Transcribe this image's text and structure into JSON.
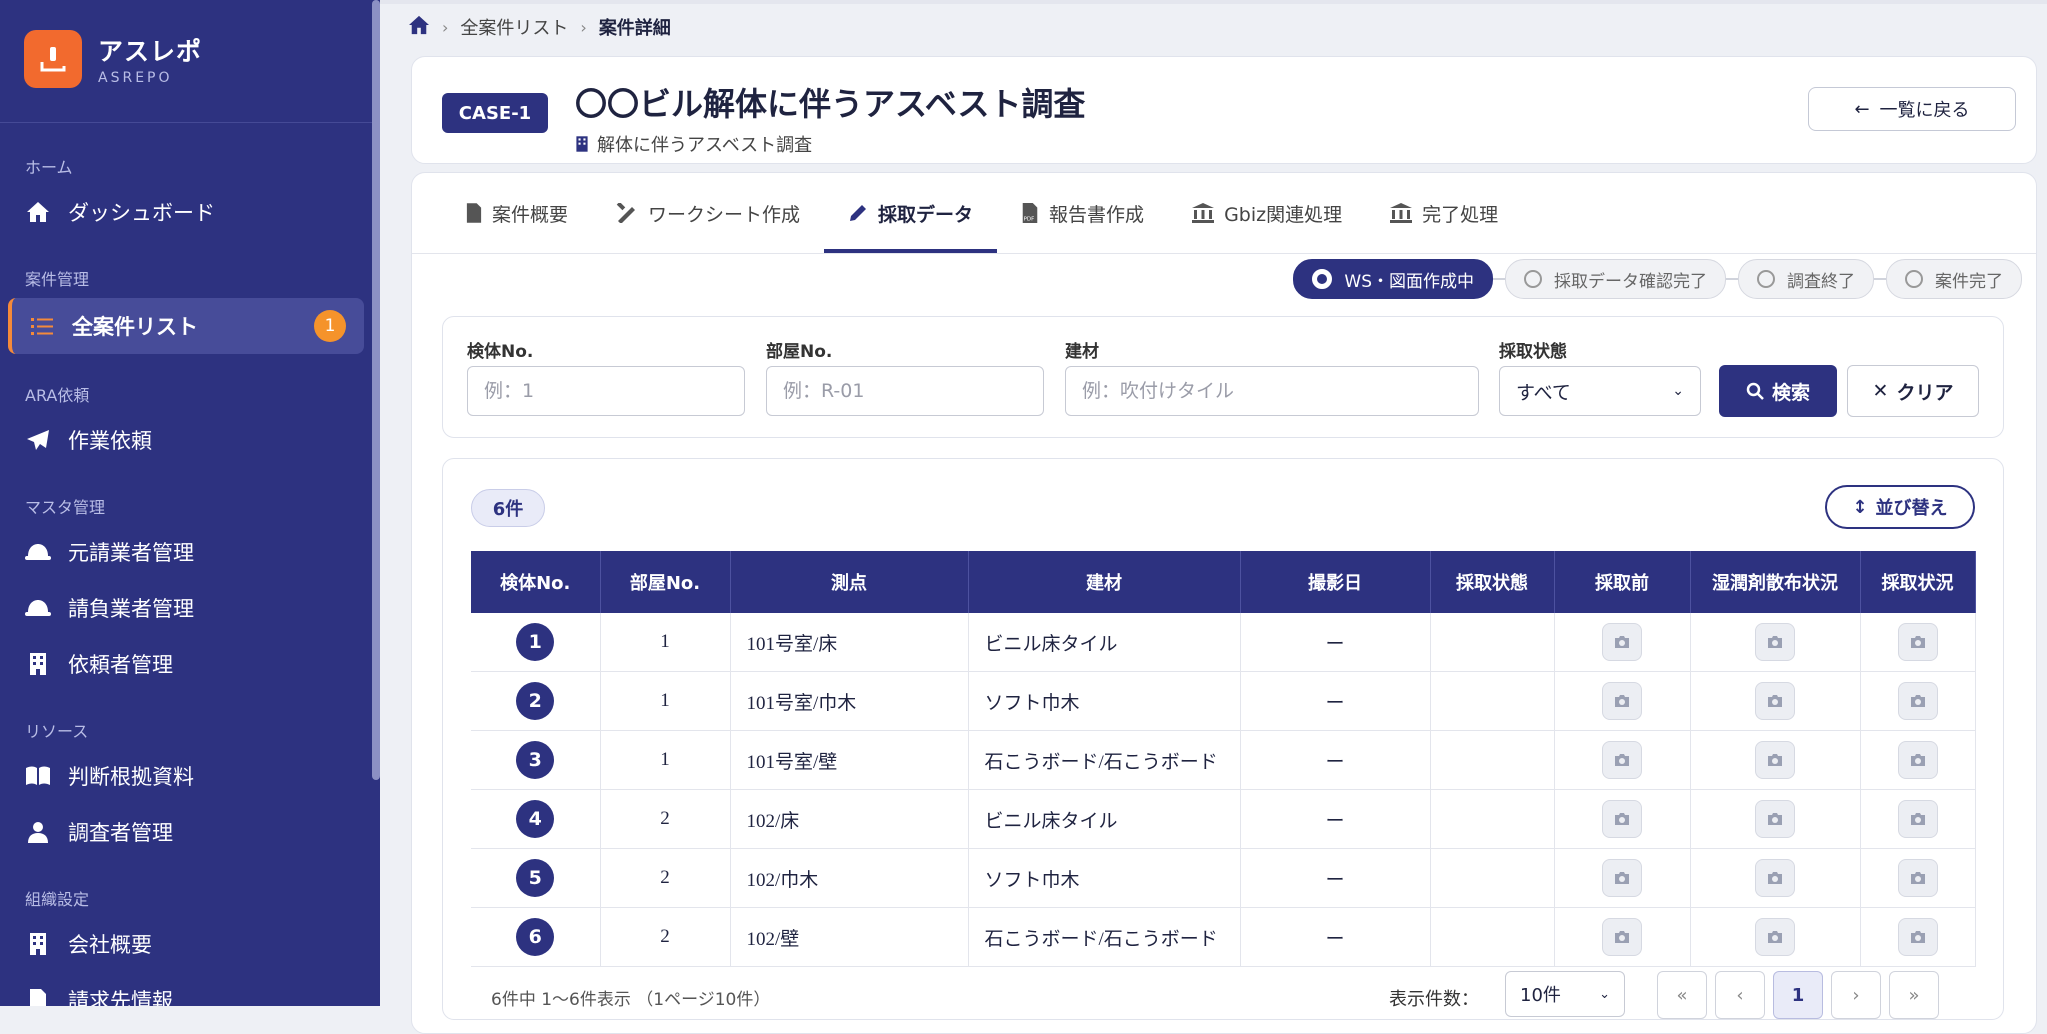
{
  "app": {
    "name": "アスレポ",
    "sub": "ASREPO"
  },
  "sidebar": {
    "sections": [
      {
        "title": "ホーム"
      },
      {
        "title": "案件管理"
      },
      {
        "title": "ARA依頼"
      },
      {
        "title": "マスタ管理"
      },
      {
        "title": "リソース"
      },
      {
        "title": "組織設定"
      }
    ],
    "items": [
      {
        "label": "ダッシュボード",
        "icon": "home-icon"
      },
      {
        "label": "全案件リスト",
        "icon": "list-icon",
        "badge": "1",
        "active": true
      },
      {
        "label": "作業依頼",
        "icon": "send-icon"
      },
      {
        "label": "元請業者管理",
        "icon": "helmet-icon"
      },
      {
        "label": "請負業者管理",
        "icon": "helmet-icon"
      },
      {
        "label": "依頼者管理",
        "icon": "building-icon"
      },
      {
        "label": "判断根拠資料",
        "icon": "book-icon"
      },
      {
        "label": "調査者管理",
        "icon": "user-icon"
      },
      {
        "label": "会社概要",
        "icon": "building-icon"
      },
      {
        "label": "請求先情報",
        "icon": "document-icon"
      }
    ]
  },
  "breadcrumb": {
    "home": "home-icon",
    "list": "全案件リスト",
    "current": "案件詳細"
  },
  "case": {
    "id": "CASE-1",
    "title": "〇〇ビル解体に伴うアスベスト調査",
    "subtitle": "解体に伴うアスベスト調査",
    "back_label": "一覧に戻る"
  },
  "tabs": [
    {
      "label": "案件概要",
      "icon": "document-icon"
    },
    {
      "label": "ワークシート作成",
      "icon": "pencil-ruler-icon"
    },
    {
      "label": "採取データ",
      "icon": "pen-icon",
      "active": true
    },
    {
      "label": "報告書作成",
      "icon": "pdf-icon"
    },
    {
      "label": "Gbiz関連処理",
      "icon": "bank-icon"
    },
    {
      "label": "完了処理",
      "icon": "bank-icon"
    }
  ],
  "status_steps": [
    {
      "label": "WS・図面作成中",
      "active": true
    },
    {
      "label": "採取データ確認完了"
    },
    {
      "label": "調査終了"
    },
    {
      "label": "案件完了"
    }
  ],
  "filters": {
    "specimen": {
      "label": "検体No.",
      "placeholder": "例：1"
    },
    "room": {
      "label": "部屋No.",
      "placeholder": "例：R-01"
    },
    "material": {
      "label": "建材",
      "placeholder": "例：吹付けタイル"
    },
    "status": {
      "label": "採取状態",
      "value": "すべて"
    },
    "search_label": "検索",
    "clear_label": "クリア"
  },
  "list": {
    "count": "6件",
    "sort_label": "並び替え",
    "columns": [
      "検体No.",
      "部屋No.",
      "測点",
      "建材",
      "撮影日",
      "採取状態",
      "採取前",
      "湿潤剤散布状況",
      "採取状況"
    ],
    "rows": [
      {
        "no": "1",
        "room": "1",
        "point": "101号室/床",
        "material": "ビニル床タイル",
        "date": "ー",
        "state": ""
      },
      {
        "no": "2",
        "room": "1",
        "point": "101号室/巾木",
        "material": "ソフト巾木",
        "date": "ー",
        "state": ""
      },
      {
        "no": "3",
        "room": "1",
        "point": "101号室/壁",
        "material": "石こうボード/石こうボード",
        "date": "ー",
        "state": ""
      },
      {
        "no": "4",
        "room": "2",
        "point": "102/床",
        "material": "ビニル床タイル",
        "date": "ー",
        "state": ""
      },
      {
        "no": "5",
        "room": "2",
        "point": "102/巾木",
        "material": "ソフト巾木",
        "date": "ー",
        "state": ""
      },
      {
        "no": "6",
        "room": "2",
        "point": "102/壁",
        "material": "石こうボード/石こうボード",
        "date": "ー",
        "state": ""
      }
    ],
    "pager_text": "6件中 1〜6件表示 （1ページ10件）",
    "per_page_label": "表示件数：",
    "per_page_value": "10件",
    "pages": {
      "first": "«",
      "prev": "‹",
      "current": "1",
      "next": "›",
      "last": "»"
    }
  }
}
